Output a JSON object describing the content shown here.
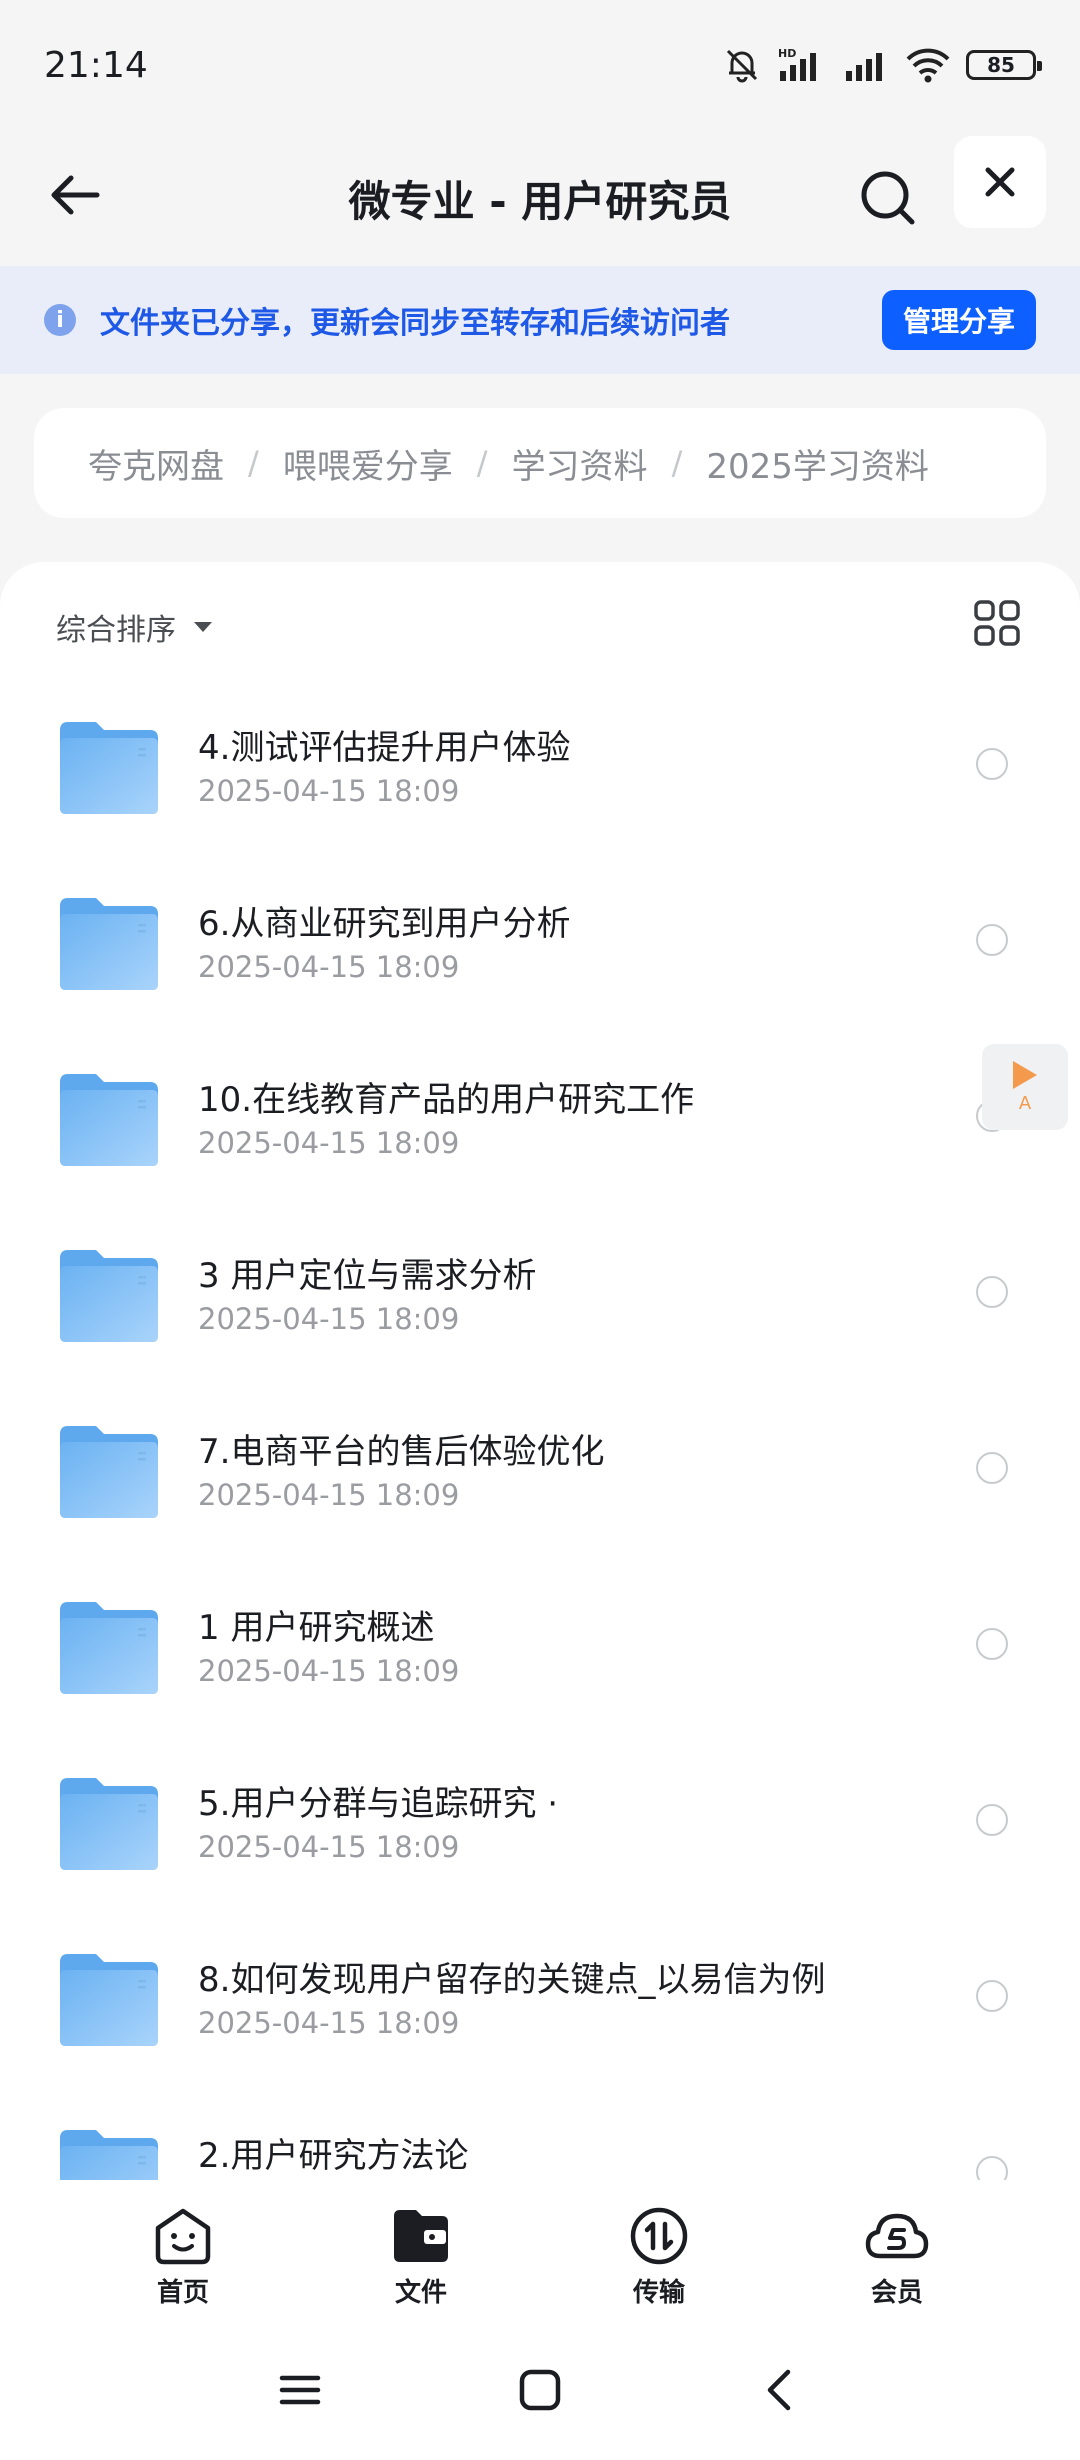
{
  "status_bar": {
    "time": "21:14",
    "battery": "85",
    "icons": [
      "bell-muted-icon",
      "hd-signal-icon",
      "signal-icon",
      "wifi-icon",
      "battery-icon"
    ]
  },
  "header": {
    "title": "微专业 - 用户研究员",
    "icons": [
      "back-arrow-icon",
      "search-icon",
      "close-icon"
    ]
  },
  "banner": {
    "text": "文件夹已分享，更新会同步至转存和后续访问者",
    "button": "管理分享",
    "icon_glyph": "i"
  },
  "breadcrumb": {
    "items": [
      "夸克网盘",
      "喂喂爱分享",
      "学习资料",
      "2025学习资料"
    ],
    "separator": "/"
  },
  "toolbar": {
    "sort_label": "综合排序"
  },
  "files": [
    {
      "name": "4.测试评估提升用户体验",
      "date": "2025-04-15 18:09"
    },
    {
      "name": "6.从商业研究到用户分析",
      "date": "2025-04-15 18:09"
    },
    {
      "name": "10.在线教育产品的用户研究工作",
      "date": "2025-04-15 18:09"
    },
    {
      "name": "3 用户定位与需求分析",
      "date": "2025-04-15 18:09"
    },
    {
      "name": "7.电商平台的售后体验优化",
      "date": "2025-04-15 18:09"
    },
    {
      "name": "1 用户研究概述",
      "date": "2025-04-15 18:09"
    },
    {
      "name": "5.用户分群与追踪研究 ·",
      "date": "2025-04-15 18:09"
    },
    {
      "name": "8.如何发现用户留存的关键点_以易信为例",
      "date": "2025-04-15 18:09"
    },
    {
      "name": "2.用户研究方法论",
      "date": ""
    }
  ],
  "float_tab": {
    "label": "A"
  },
  "bottom_nav": [
    {
      "label": "首页",
      "icon": "home-face-icon"
    },
    {
      "label": "文件",
      "icon": "folder-wallet-icon"
    },
    {
      "label": "传输",
      "icon": "transfer-icon"
    },
    {
      "label": "会员",
      "icon": "vip-cloud-icon"
    }
  ],
  "colors": {
    "accent": "#0d5fff",
    "banner_bg": "#e8edf9",
    "banner_text": "#1e58e6",
    "folder": "#8ec5f7"
  }
}
